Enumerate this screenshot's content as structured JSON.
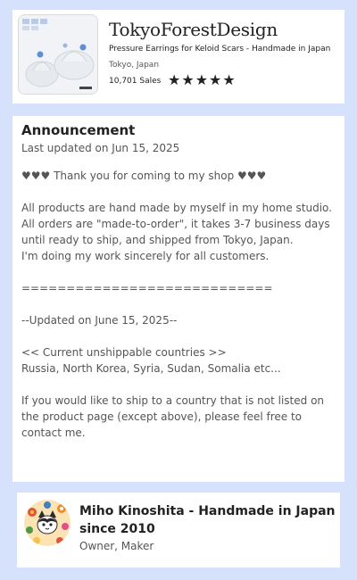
{
  "shop": {
    "name": "TokyoForestDesign",
    "tagline": "Pressure Earrings for Keloid Scars - Handmade in Japan",
    "location": "Tokyo, Japan",
    "sales": "10,701 Sales",
    "rating_stars": 5,
    "stars_display": "★★★★★",
    "thumbnail_icon": "earring-product-photo"
  },
  "announcement": {
    "title": "Announcement",
    "updated": "Last updated on Jun 15, 2025",
    "lines": [
      "♥♥♥ Thank you for coming to my shop ♥♥♥",
      "",
      "All products are hand made by myself in my home studio.",
      "All orders are \"made-to-order\", it takes 3-7 business days until ready to ship, and shipped from Tokyo, Japan.",
      "I'm doing my work sincerely for all customers.",
      "",
      "============================",
      "",
      "--Updated on June 15, 2025--",
      "",
      "<< Current unshippable countries >>",
      "Russia, North Korea, Syria, Sudan, Somalia etc...",
      "",
      "If you would like to ship to a country that is not listed on the product page (except above), please feel free to contact me."
    ]
  },
  "owner": {
    "name": "Miho Kinoshita - Handmade in Japan since 2010",
    "role": "Owner, Maker",
    "avatar_icon": "cat-avatar-icon"
  },
  "colors": {
    "page_background": "#d6e2fb",
    "card_background": "#ffffff",
    "text_primary": "#222222",
    "text_secondary": "#555555"
  }
}
